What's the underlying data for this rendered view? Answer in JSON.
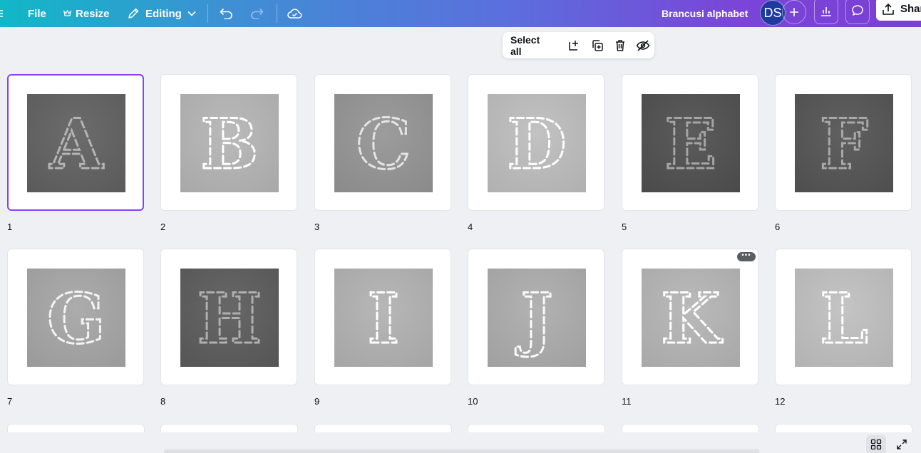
{
  "topbar": {
    "file_label": "File",
    "resize_label": "Resize",
    "editing_label": "Editing",
    "design_title": "Brancusi alphabet",
    "avatar_initials": "DS",
    "share_label": "Shar"
  },
  "page_toolbar": {
    "select_all_label": "Select all"
  },
  "pages": [
    {
      "number": "1",
      "letter": "A",
      "bg": "#5a5a5a",
      "selected": true
    },
    {
      "number": "2",
      "letter": "B",
      "bg": "#a8a8a8",
      "selected": false
    },
    {
      "number": "3",
      "letter": "C",
      "bg": "#8a8a8a",
      "selected": false
    },
    {
      "number": "4",
      "letter": "D",
      "bg": "#b0b0b0",
      "selected": false
    },
    {
      "number": "5",
      "letter": "E",
      "bg": "#4a4a4a",
      "selected": false
    },
    {
      "number": "6",
      "letter": "F",
      "bg": "#4e4e4e",
      "selected": false
    },
    {
      "number": "7",
      "letter": "G",
      "bg": "#9a9a9a",
      "selected": false
    },
    {
      "number": "8",
      "letter": "H",
      "bg": "#555555",
      "selected": false
    },
    {
      "number": "9",
      "letter": "I",
      "bg": "#a5a5a5",
      "selected": false
    },
    {
      "number": "10",
      "letter": "J",
      "bg": "#a0a0a0",
      "selected": false
    },
    {
      "number": "11",
      "letter": "K",
      "bg": "#a8a8a8",
      "selected": false
    },
    {
      "number": "12",
      "letter": "L",
      "bg": "#b2b2b2",
      "selected": false
    }
  ],
  "page_more_label": "•••",
  "colors": {
    "accent": "#8b3dff",
    "canvas_bg": "#eff0f4"
  }
}
